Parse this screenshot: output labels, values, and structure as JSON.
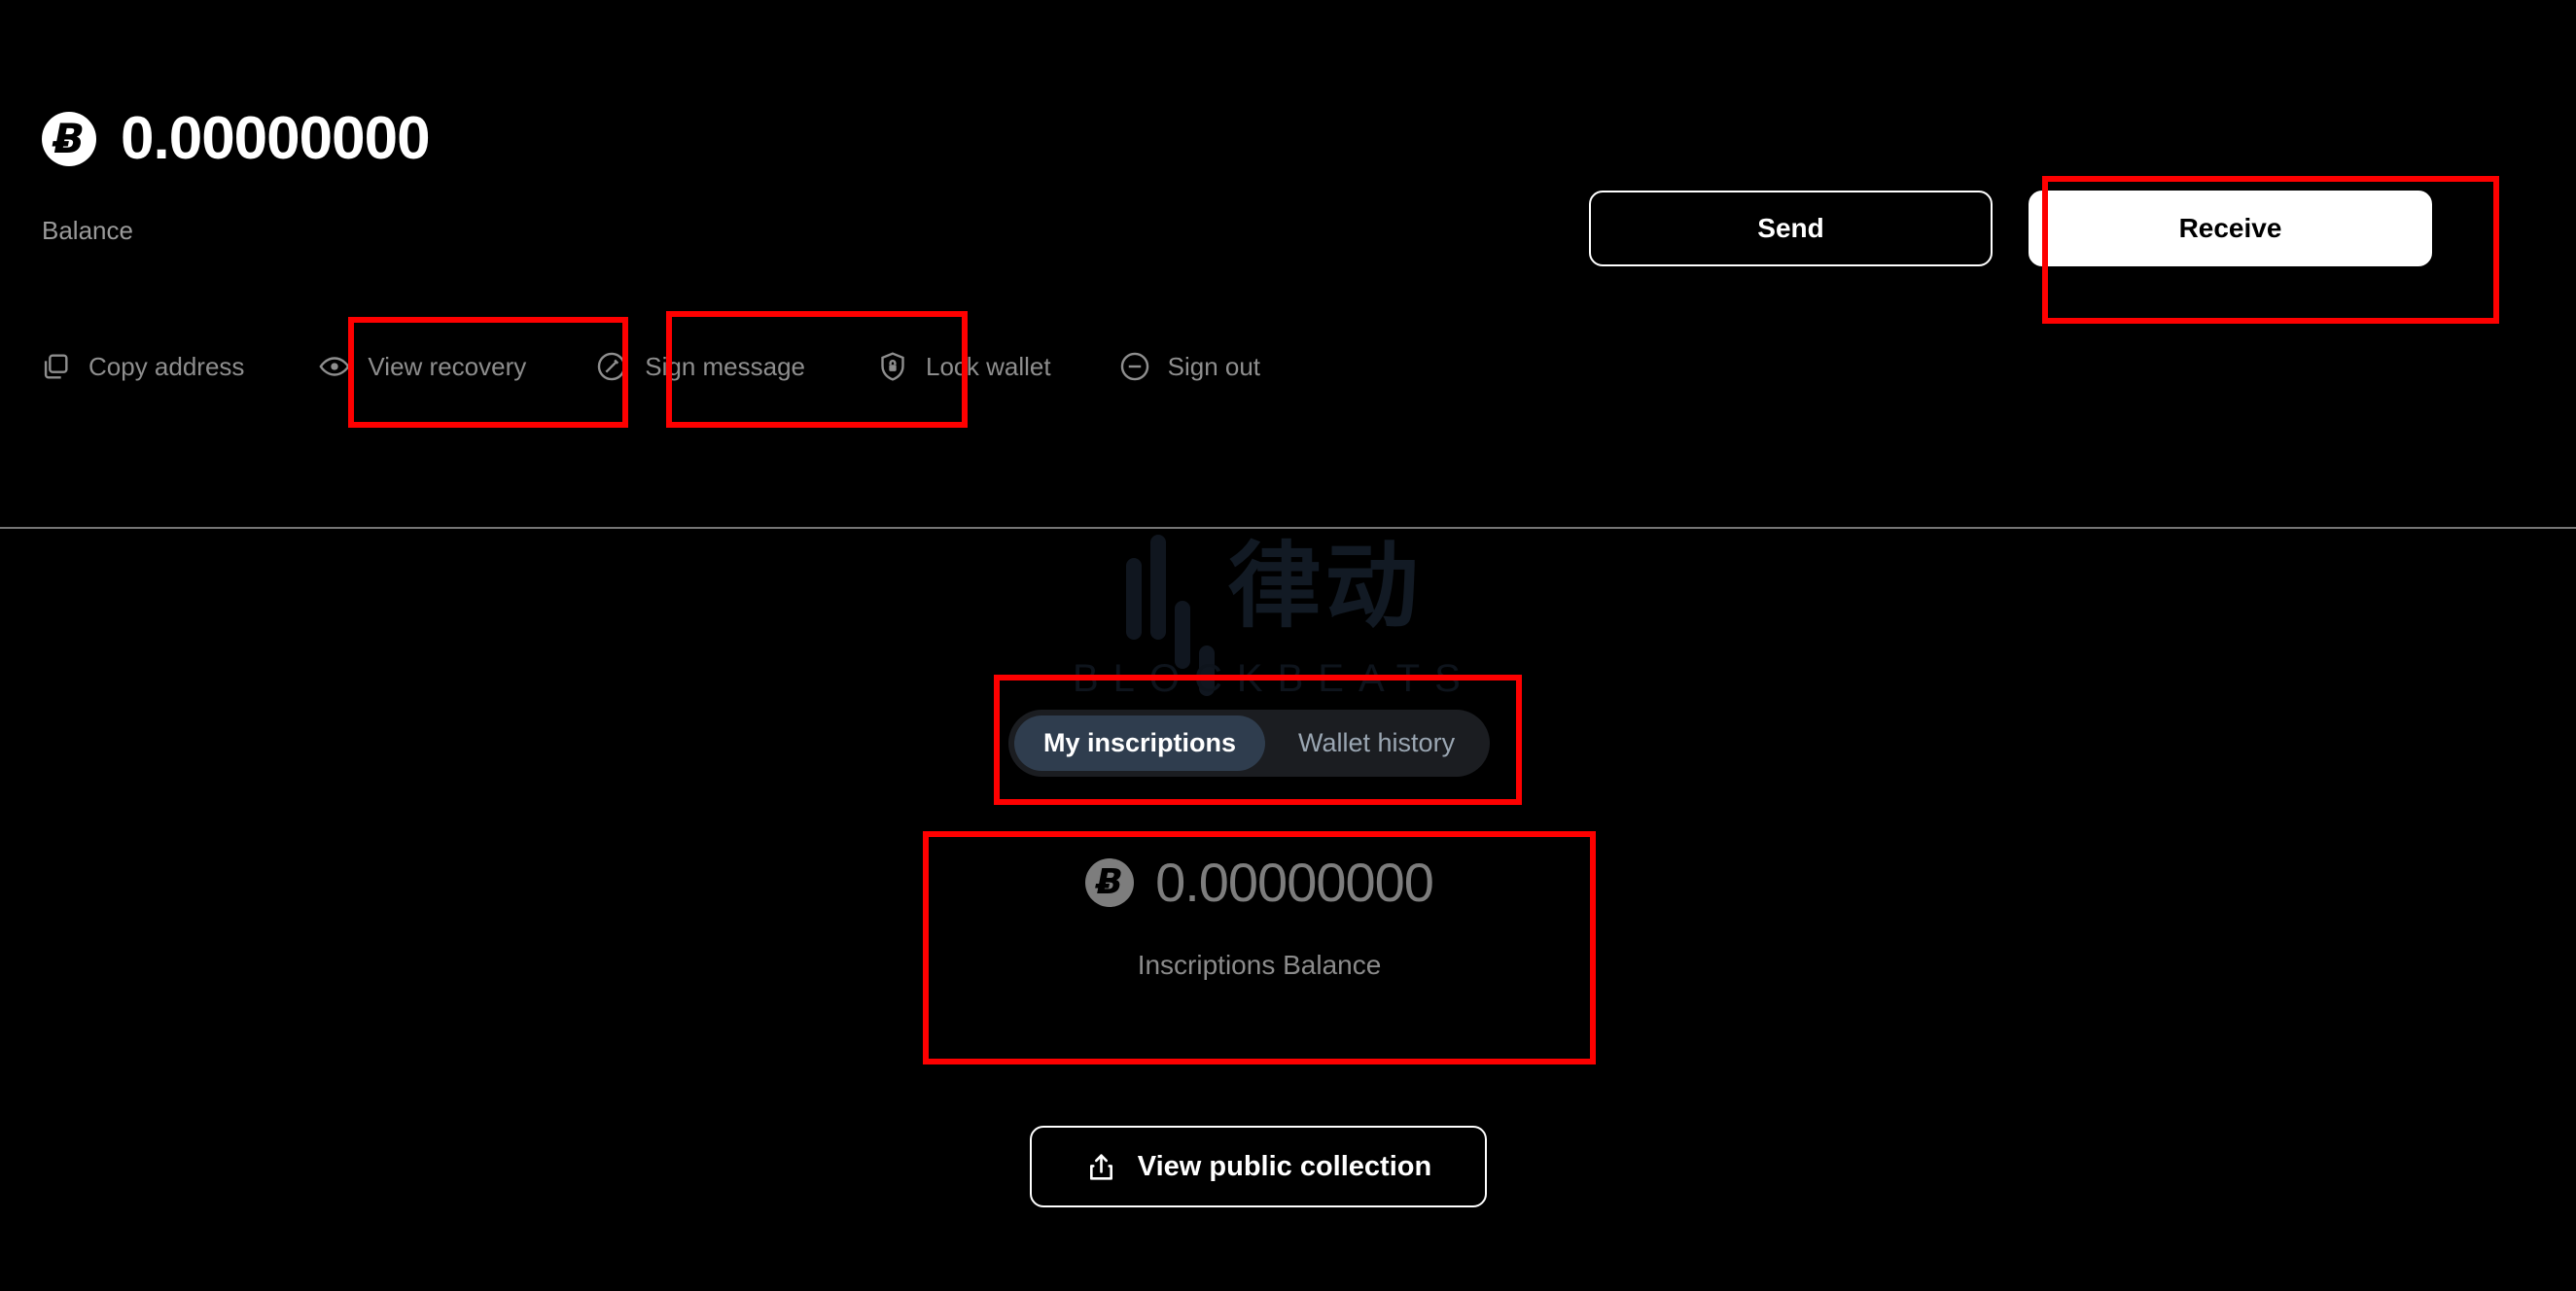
{
  "wallet": {
    "balance_amount": "0.00000000",
    "balance_label": "Balance",
    "currency_symbol": "Ƀ",
    "currency_icon": "bitcoin-icon"
  },
  "cta": {
    "send_label": "Send",
    "receive_label": "Receive"
  },
  "actions": [
    {
      "label": "Copy address",
      "icon": "copy-icon"
    },
    {
      "label": "View recovery",
      "icon": "eye-icon"
    },
    {
      "label": "Sign message",
      "icon": "pen-circle-icon"
    },
    {
      "label": "Lock wallet",
      "icon": "shield-lock-icon"
    },
    {
      "label": "Sign out",
      "icon": "minus-circle-icon"
    }
  ],
  "tabs": [
    {
      "label": "My inscriptions",
      "active": true
    },
    {
      "label": "Wallet history",
      "active": false
    }
  ],
  "inscriptions": {
    "amount": "0.00000000",
    "label": "Inscriptions Balance",
    "currency_icon": "bitcoin-icon"
  },
  "collection": {
    "label": "View public collection",
    "icon": "share-upload-icon"
  },
  "watermark": {
    "cjk": "律动",
    "latin": "BLOCKBEATS"
  },
  "colors": {
    "background": "#000000",
    "text_primary": "#ffffff",
    "text_muted": "#8e8e8e",
    "accent_filled": "#ffffff",
    "tab_active_bg": "#2f3d4e",
    "tab_track_bg": "#1b1d21",
    "annotation": "#fe0000",
    "divider": "#8a8a8a"
  }
}
